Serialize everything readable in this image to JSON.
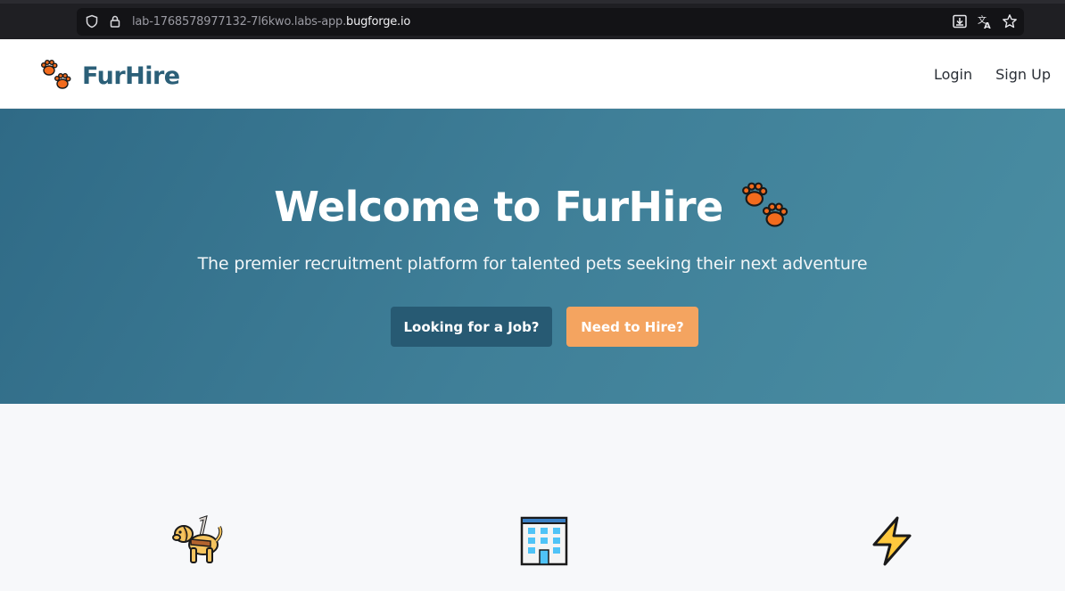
{
  "browser": {
    "url_prefix": "lab-1768578977132-7l6kwo.labs-app.",
    "url_host": "bugforge.io",
    "icons": [
      "shield-icon",
      "lock-icon",
      "download-icon",
      "translate-icon",
      "star-icon"
    ]
  },
  "nav": {
    "brand": "FurHire",
    "brand_icon": "paw-prints-icon",
    "login": "Login",
    "signup": "Sign Up"
  },
  "hero": {
    "title": "Welcome to FurHire",
    "title_icon": "paw-prints-icon",
    "subtitle": "The premier recruitment platform for talented pets seeking their next adventure",
    "job_button": "Looking for a Job?",
    "hire_button": "Need to Hire?"
  },
  "features": {
    "icons": [
      "service-dog-icon",
      "office-building-icon",
      "lightning-icon"
    ]
  },
  "colors": {
    "brand": "#2b5f78",
    "hero_start": "#2f6a86",
    "hero_end": "#4a8ea3",
    "primary_button": "#275a73",
    "accent_button": "#f4a460"
  }
}
